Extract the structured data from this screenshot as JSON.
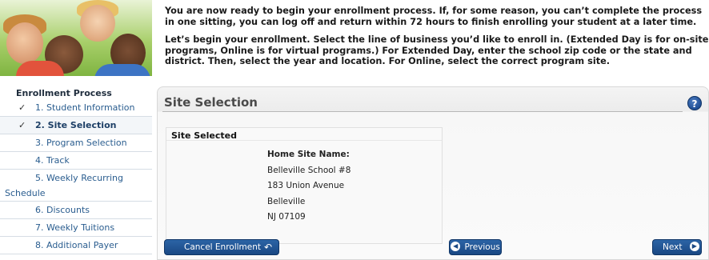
{
  "intro": {
    "paragraph1": "You are now ready to begin your enrollment process. If, for some reason, you can’t complete the process in one sitting, you can log off and return within 72 hours to finish enrolling your student at a later time.",
    "paragraph2": "Let’s begin your enrollment. Select the line of business you’d like to enroll in. (Extended Day is for on-site programs, Online is for virtual programs.) For Extended Day, enter the school zip code or the state and district. Then, select the year and location. For Online, select the correct program site."
  },
  "sidebar": {
    "title": "Enrollment Process",
    "items": [
      {
        "label": "1. Student Information",
        "checked": true,
        "active": false
      },
      {
        "label": "2. Site Selection",
        "checked": true,
        "active": true
      },
      {
        "label": "3. Program Selection",
        "checked": false,
        "active": false
      },
      {
        "label": "4. Track",
        "checked": false,
        "active": false
      },
      {
        "label_line1": "5. Weekly Recurring",
        "label_line2": "Schedule",
        "checked": false,
        "active": false
      },
      {
        "label": "6. Discounts",
        "checked": false,
        "active": false
      },
      {
        "label": "7. Weekly Tuitions",
        "checked": false,
        "active": false
      },
      {
        "label": "8. Additional Payer",
        "checked": false,
        "active": false
      }
    ],
    "check_glyph": "✓"
  },
  "main": {
    "title": "Site Selection",
    "help_label": "?",
    "site_selected": {
      "title": "Site Selected",
      "header": "Home Site Name:",
      "name": "Belleville School #8",
      "street": "183 Union Avenue",
      "city": "Belleville",
      "state_zip": "NJ 07109"
    }
  },
  "buttons": {
    "cancel_label": "Cancel Enrollment",
    "cancel_icon": "↶",
    "previous_label": "Previous",
    "previous_icon": "◀",
    "next_label": "Next",
    "next_icon": "▶"
  },
  "colors": {
    "button_blue": "#1a4883",
    "link_blue": "#2a5d8f",
    "help_blue": "#1f4f96"
  }
}
